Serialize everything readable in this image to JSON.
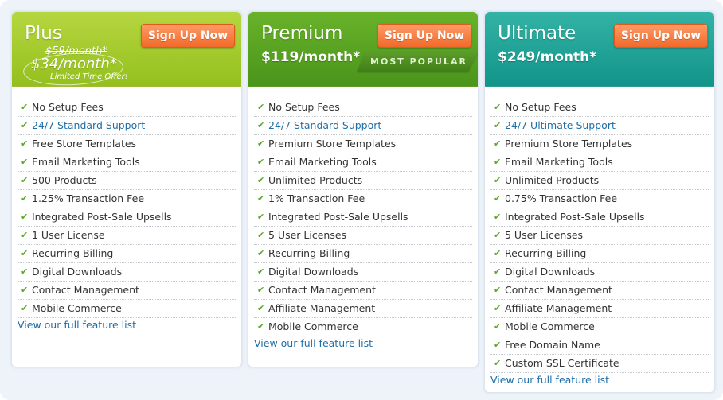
{
  "plans": {
    "plus": {
      "name": "Plus",
      "old_price": "$59/month*",
      "price": "$34/month*",
      "promo_note": "Limited Time Offer!",
      "signup_label": "Sign Up Now",
      "link_label": "View our full feature list",
      "features": [
        "No Setup Fees",
        "24/7 Standard Support",
        "Free Store Templates",
        "Email Marketing Tools",
        "500 Products",
        "1.25% Transaction Fee",
        "Integrated Post-Sale Upsells",
        "1 User License",
        "Recurring Billing",
        "Digital Downloads",
        "Contact Management",
        "Mobile Commerce"
      ]
    },
    "premium": {
      "name": "Premium",
      "price": "$119/month*",
      "ribbon": "MOST POPULAR",
      "signup_label": "Sign Up Now",
      "link_label": "View our full feature list",
      "features": [
        "No Setup Fees",
        "24/7 Standard Support",
        "Premium Store Templates",
        "Email Marketing Tools",
        "Unlimited Products",
        "1% Transaction Fee",
        "Integrated Post-Sale Upsells",
        "5 User Licenses",
        "Recurring Billing",
        "Digital Downloads",
        "Contact Management",
        "Affiliate Management",
        "Mobile Commerce"
      ]
    },
    "ultimate": {
      "name": "Ultimate",
      "price": "$249/month*",
      "signup_label": "Sign Up Now",
      "link_label": "View our full feature list",
      "features": [
        "No Setup Fees",
        "24/7 Ultimate Support",
        "Premium Store Templates",
        "Email Marketing Tools",
        "Unlimited Products",
        "0.75% Transaction Fee",
        "Integrated Post-Sale Upsells",
        "5 User Licenses",
        "Recurring Billing",
        "Digital Downloads",
        "Contact Management",
        "Affiliate Management",
        "Mobile Commerce",
        "Free Domain Name",
        "Custom SSL Certificate"
      ]
    }
  },
  "icons": {
    "feature_check": "check-icon"
  },
  "colors": {
    "plus_header": "#a3cb2e",
    "premium_header": "#58a322",
    "ultimate_header": "#22a497",
    "signup_button": "#f57b3d",
    "link": "#1f6fa8",
    "check": "#5aa52a"
  }
}
